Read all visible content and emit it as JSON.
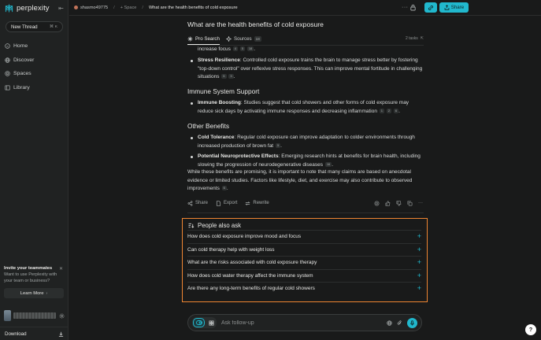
{
  "colors": {
    "accent": "#21b8cd",
    "highlight": "#f08632",
    "background": "#191a1a",
    "sidebar": "#202222"
  },
  "sidebar": {
    "brand": "perplexity",
    "new_thread": {
      "label": "New Thread",
      "shortcut_1": "⌘",
      "shortcut_2": "K"
    },
    "items": [
      {
        "label": "Home",
        "icon": "home-icon"
      },
      {
        "label": "Discover",
        "icon": "globe-icon"
      },
      {
        "label": "Spaces",
        "icon": "spaces-icon"
      },
      {
        "label": "Library",
        "icon": "library-icon"
      }
    ],
    "invite": {
      "title": "Invite your teammates",
      "text": "Want to use Perplexity with your team or business?",
      "button": "Learn More",
      "arrow": "›"
    },
    "download_label": "Download"
  },
  "topbar": {
    "user": "shasmo49775",
    "space": "Space",
    "title": "What are the health benefits of cold exposure",
    "more": "···",
    "share_label": "Share"
  },
  "thread": {
    "title": "What are the health benefits of cold exposure",
    "tabs": [
      {
        "label": "Pro Search"
      },
      {
        "label": "Sources",
        "count": "18"
      }
    ],
    "tasks_label": "2 tasks",
    "tasks_icon": "⇱"
  },
  "answer": {
    "partial_line": {
      "text": "increase focus",
      "cites": [
        "4",
        "5",
        "18"
      ]
    },
    "stress": {
      "label": "Stress Resilience",
      "text": ": Controlled cold exposure trains the brain to manage stress better by fostering \"top-down control\" over reflexive stress responses. This can improve mental fortitude in challenging situations",
      "cites": [
        "5",
        "3"
      ]
    },
    "immune_heading": "Immune System Support",
    "immune": {
      "label": "Immune Boosting",
      "text": ": Studies suggest that cold showers and other forms of cold exposure may reduce sick days by activating immune responses and decreasing inflammation",
      "cites": [
        "1",
        "2",
        "6"
      ]
    },
    "other_heading": "Other Benefits",
    "cold_tolerance": {
      "label": "Cold Tolerance",
      "text": ": Regular cold exposure can improve adaptation to colder environments through increased production of brown fat",
      "cites": [
        "5"
      ]
    },
    "neuro": {
      "label": "Potential Neuroprotective Effects",
      "text": ": Emerging research hints at benefits for brain health, including slowing the progression of neurodegenerative diseases",
      "cites": [
        "16"
      ]
    },
    "conclusion": {
      "text": "While these benefits are promising, it is important to note that many claims are based on anecdotal evidence or limited studies. Factors like lifestyle, diet, and exercise may also contribute to observed improvements",
      "cites": [
        "6"
      ]
    }
  },
  "actions": {
    "share": "Share",
    "export": "Export",
    "rewrite": "Rewrite"
  },
  "people_also_ask": {
    "title": "People also ask",
    "questions": [
      "How does cold exposure improve mood and focus",
      "Can cold therapy help with weight loss",
      "What are the risks associated with cold exposure therapy",
      "How does cold water therapy affect the immune system",
      "Are there any long-term benefits of regular cold showers"
    ],
    "plus": "+"
  },
  "ask": {
    "placeholder": "Ask follow-up"
  },
  "help_label": "?"
}
